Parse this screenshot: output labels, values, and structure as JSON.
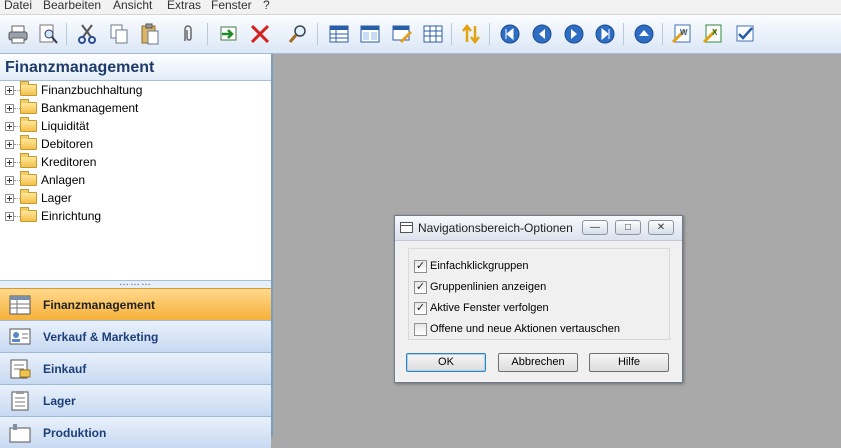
{
  "menu": [
    "Datei",
    "Bearbeiten",
    "Ansicht",
    "Extras",
    "Fenster",
    "?"
  ],
  "toolbar": [
    "print-icon",
    "print-preview-icon",
    "cut-icon",
    "copy-icon",
    "paste-icon",
    "attach-icon",
    "go-icon",
    "delete-icon",
    "find-icon",
    "list-view-icon",
    "card-view-icon",
    "table-edit-icon",
    "matrix-icon",
    "sort-icon",
    "first-record-icon",
    "previous-record-icon",
    "next-record-icon",
    "last-record-icon",
    "up-icon",
    "export-word-icon",
    "export-excel-icon",
    "approve-icon"
  ],
  "nav": {
    "title": "Finanzmanagement",
    "tree": [
      "Finanzbuchhaltung",
      "Bankmanagement",
      "Liquidität",
      "Debitoren",
      "Kreditoren",
      "Anlagen",
      "Lager",
      "Einrichtung"
    ],
    "grip": "………",
    "buttons": [
      "Finanzmanagement",
      "Verkauf & Marketing",
      "Einkauf",
      "Lager",
      "Produktion"
    ]
  },
  "dialog": {
    "title": "Navigationsbereich-Optionen",
    "checkboxes": [
      {
        "label": "Einfachklickgruppen",
        "checked": true
      },
      {
        "label": "Gruppenlinien anzeigen",
        "checked": true
      },
      {
        "label": "Aktive Fenster verfolgen",
        "checked": true
      },
      {
        "label": "Offene und neue Aktionen vertauschen",
        "checked": false
      }
    ],
    "check_mark": "✓",
    "buttons": {
      "ok": "OK",
      "cancel": "Abbrechen",
      "help": "Hilfe"
    },
    "window_controls": {
      "minimize": "—",
      "restore": "□",
      "close": "✕"
    }
  }
}
